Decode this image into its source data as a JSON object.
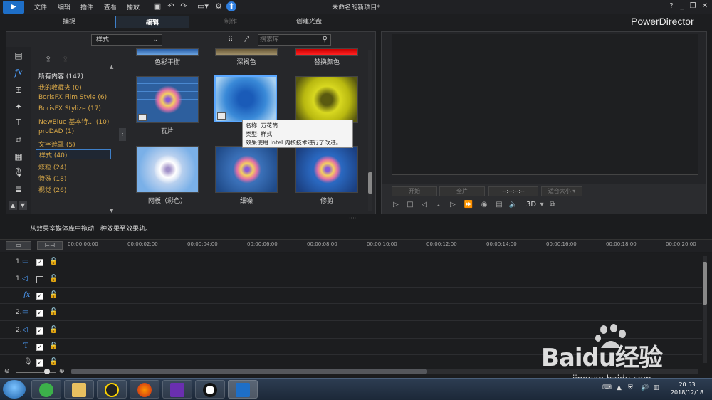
{
  "menu": {
    "items": [
      "文件",
      "编辑",
      "插件",
      "查看",
      "播放"
    ]
  },
  "project_title": "未命名的新项目*",
  "window_controls": {
    "help": "?"
  },
  "modes": [
    {
      "label": "捕捉"
    },
    {
      "label": "编辑"
    },
    {
      "label": "制作"
    },
    {
      "label": "创建光盘"
    }
  ],
  "brand": "PowerDirector",
  "library": {
    "filter_value": "样式",
    "search_placeholder": "搜索库",
    "categories": [
      {
        "label": "所有内容 (147)"
      },
      {
        "label": "我的收藏夹 (0)"
      },
      {
        "label": "BorisFX Film Style (6)"
      },
      {
        "label": "BorisFX Stylize (17)"
      },
      {
        "label": "NewBlue 基本特... (10)"
      },
      {
        "label": "proDAD (1)"
      },
      {
        "label": "文字遮罩 (5)"
      },
      {
        "label": "样式 (40)"
      },
      {
        "label": "炫粒 (24)"
      },
      {
        "label": "特殊 (18)"
      },
      {
        "label": "视觉 (26)"
      }
    ],
    "effects": [
      {
        "label": "色彩平衡"
      },
      {
        "label": "深褐色"
      },
      {
        "label": "替换颜色"
      },
      {
        "label": "瓦片"
      },
      {
        "label": "万"
      },
      {
        "label": ""
      },
      {
        "label": "网板（彩色）"
      },
      {
        "label": "细噪"
      },
      {
        "label": "修剪"
      }
    ],
    "tooltip": {
      "line1": "名称: 万花筒",
      "line2": "类型: 样式",
      "line3": "效果使用 Intel 内核技术进行了改进。"
    }
  },
  "preview": {
    "mark_in": "开始",
    "mark_out": "全片",
    "timecode": "--:--:--:--",
    "fit": "适合大小",
    "mode_3d": "3D"
  },
  "status_text": "从效果室媒体库中拖动一种效果至效果轨。",
  "timeline": {
    "ticks": [
      "00:00:00:00",
      "00:00:02:00",
      "00:00:04:00",
      "00:00:06:00",
      "00:00:08:00",
      "00:00:10:00",
      "00:00:12:00",
      "00:00:14:00",
      "00:00:16:00",
      "00:00:18:00",
      "00:00:20:00"
    ],
    "tracks": [
      {
        "num": "1.",
        "checked": true
      },
      {
        "num": "1.",
        "checked": false
      },
      {
        "num": "",
        "checked": true
      },
      {
        "num": "2.",
        "checked": true
      },
      {
        "num": "2.",
        "checked": true
      },
      {
        "num": "",
        "checked": true
      },
      {
        "num": "",
        "checked": true
      }
    ]
  },
  "taskbar": {
    "time": "20:53",
    "date": "2018/12/18"
  },
  "watermark": {
    "text": "Baidu经验",
    "url": "jingyan.baidu.com"
  }
}
